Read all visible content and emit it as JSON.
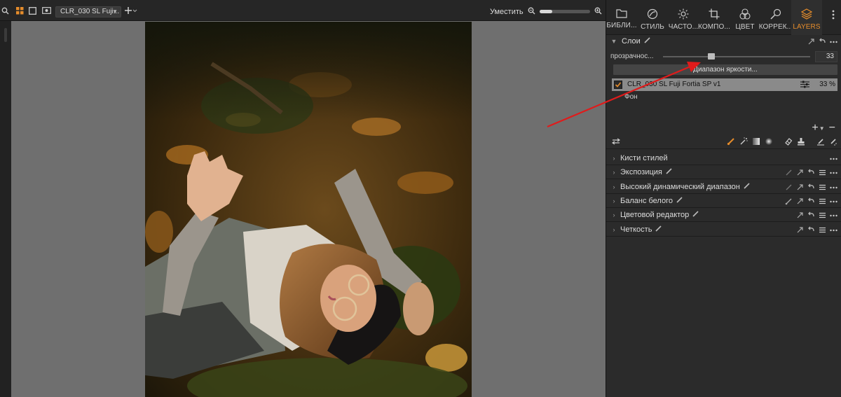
{
  "toolbar": {
    "variant_name": "CLR_030 SL Fuji...",
    "fit_label": "Уместить",
    "zoom_level": 0.25,
    "icons": [
      "search-icon",
      "grid-view-icon",
      "single-view-icon",
      "eye-icon",
      "add-icon",
      "zoom-icon",
      "zoom-in-icon"
    ]
  },
  "tabs": [
    {
      "label": "БИБЛИ...",
      "icon": "folder-icon"
    },
    {
      "label": "СТИЛЬ",
      "icon": "style-icon"
    },
    {
      "label": "ЧАСТО...",
      "icon": "sun-icon"
    },
    {
      "label": "КОМПО...",
      "icon": "crop-icon"
    },
    {
      "label": "ЦВЕТ",
      "icon": "color-circles-icon"
    },
    {
      "label": "КОРРЕК...",
      "icon": "brush-icon"
    },
    {
      "label": "LAYERS",
      "icon": "layers-icon"
    }
  ],
  "accent_color": "#e58c2b",
  "layers": {
    "title": "Слои",
    "opacity_label": "прозрачнос...",
    "opacity_value": "33",
    "opacity_fraction": 0.33,
    "range_button": "Диапазон яркости...",
    "active_layer": {
      "name": "CLR_030 SL Fuji Fortia SP v1",
      "percent": "33 %",
      "checked": true
    },
    "background_layer": "Фон"
  },
  "tools": [
    {
      "label": "Кисти стилей"
    },
    {
      "label": "Экспозиция"
    },
    {
      "label": "Высокий динамический диапазон"
    },
    {
      "label": "Баланс белого"
    },
    {
      "label": "Цветовой редактор"
    },
    {
      "label": "Четкость"
    }
  ],
  "annotation_color": "#e01b1b"
}
